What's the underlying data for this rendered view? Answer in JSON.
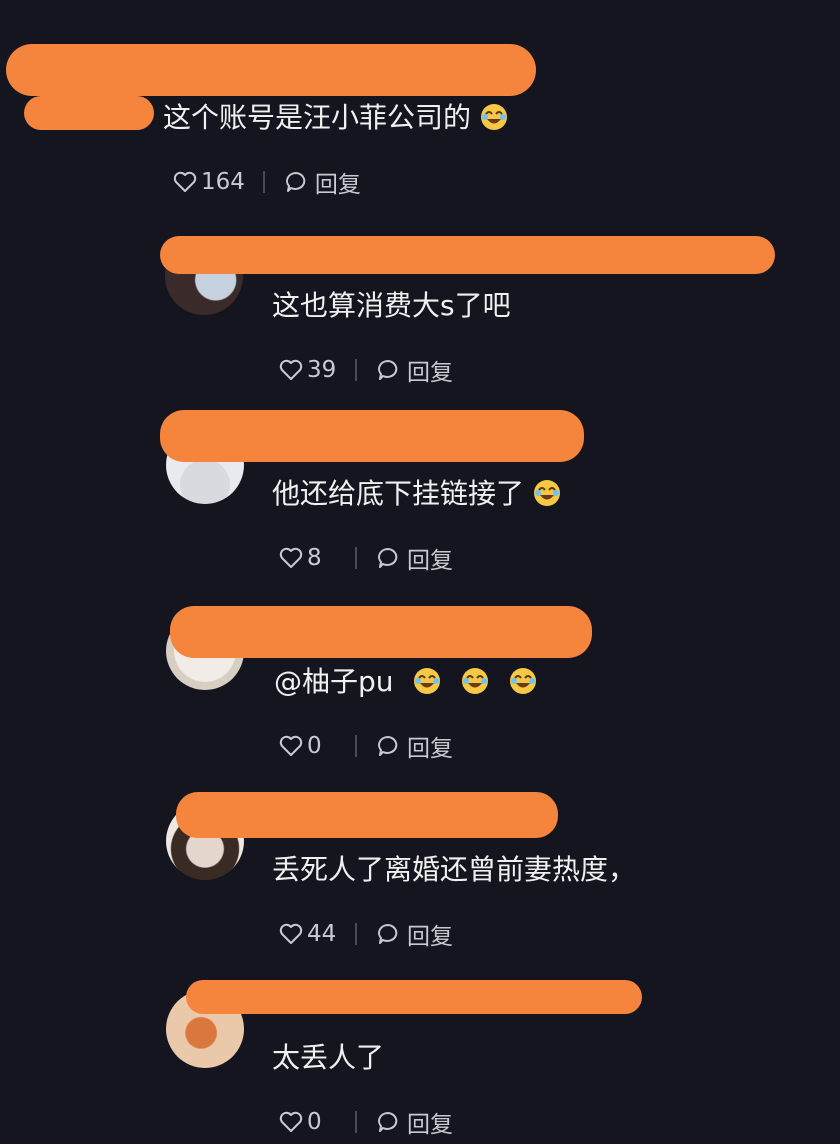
{
  "comments": [
    {
      "text": "这个账号是汪小菲公司的",
      "emojis": 1,
      "likes": "164",
      "reply_label": "回复"
    },
    {
      "text": "这也算消费大s了吧",
      "emojis": 0,
      "likes": "39",
      "reply_label": "回复"
    },
    {
      "text": "他还给底下挂链接了",
      "emojis": 1,
      "likes": "8",
      "reply_label": "回复"
    },
    {
      "text": "@柚子pu",
      "emojis": 3,
      "likes": "0",
      "reply_label": "回复"
    },
    {
      "text": "丢死人了离婚还曾前妻热度，",
      "emojis": 0,
      "likes": "44",
      "reply_label": "回复"
    },
    {
      "text": "太丢人了",
      "emojis": 0,
      "likes": "0",
      "reply_label": "回复"
    }
  ],
  "colors": {
    "background": "#15151f",
    "redaction": "#f5843d",
    "emoji_face": "#f7c843"
  },
  "icons": {
    "like": "heart-outline-icon",
    "reply": "speech-bubble-icon",
    "emoji": "laughing-face-emoji"
  }
}
